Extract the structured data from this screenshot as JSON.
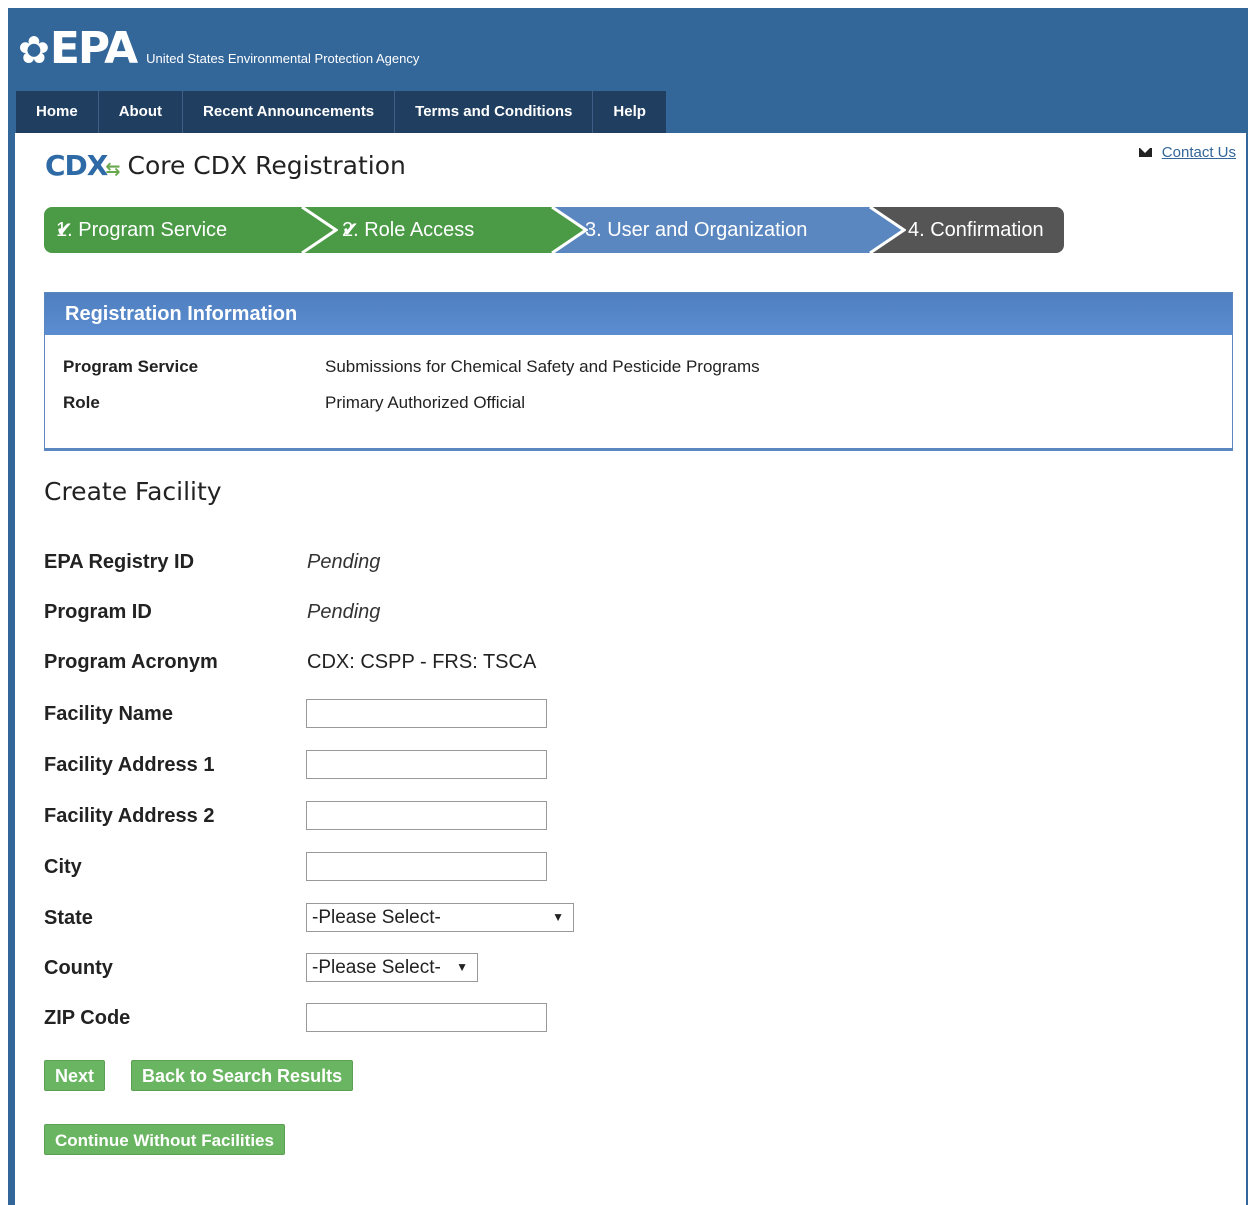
{
  "header": {
    "logo_text": "EPA",
    "agency_name": "United States Environmental Protection Agency"
  },
  "nav": {
    "items": [
      {
        "label": "Home"
      },
      {
        "label": "About"
      },
      {
        "label": "Recent Announcements"
      },
      {
        "label": "Terms and Conditions"
      },
      {
        "label": "Help"
      }
    ]
  },
  "contact_link": "Contact Us",
  "page": {
    "logo": "CDX",
    "title": "Core CDX Registration"
  },
  "steps": [
    {
      "label": "1. Program Service",
      "status": "complete",
      "mark": "✔"
    },
    {
      "label": "2. Role Access",
      "status": "complete",
      "mark": "✔"
    },
    {
      "label": "3. User and Organization",
      "status": "current",
      "mark": ""
    },
    {
      "label": "4. Confirmation",
      "status": "upcoming",
      "mark": ""
    }
  ],
  "colors": {
    "brand_blue": "#336699",
    "step_complete": "#4a9a46",
    "step_current": "#5b87c0",
    "step_upcoming": "#555555",
    "button_green": "#6ab561"
  },
  "registration_info": {
    "heading": "Registration Information",
    "rows": [
      {
        "key": "Program Service",
        "value": "Submissions for Chemical Safety and Pesticide Programs"
      },
      {
        "key": "Role",
        "value": "Primary Authorized Official"
      }
    ]
  },
  "facility": {
    "heading": "Create Facility",
    "registry_id": {
      "label": "EPA Registry ID",
      "value": "Pending"
    },
    "program_id": {
      "label": "Program ID",
      "value": "Pending"
    },
    "program_acronym": {
      "label": "Program Acronym",
      "value": "CDX: CSPP - FRS: TSCA"
    },
    "name": {
      "label": "Facility Name",
      "value": ""
    },
    "address1": {
      "label": "Facility Address 1",
      "value": ""
    },
    "address2": {
      "label": "Facility Address 2",
      "value": ""
    },
    "city": {
      "label": "City",
      "value": ""
    },
    "state": {
      "label": "State",
      "selected": "-Please Select-"
    },
    "county": {
      "label": "County",
      "selected": "-Please Select-"
    },
    "zip": {
      "label": "ZIP Code",
      "value": ""
    }
  },
  "buttons": {
    "next": "Next",
    "back": "Back to Search Results",
    "continue": "Continue Without Facilities"
  }
}
